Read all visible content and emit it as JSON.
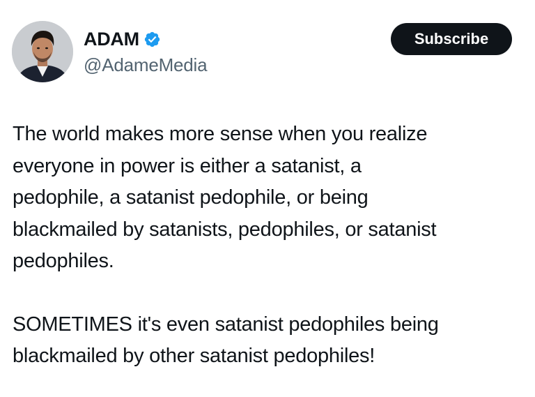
{
  "author": {
    "display_name": "ADAM",
    "handle": "@AdameMedia",
    "verified": true
  },
  "actions": {
    "subscribe_label": "Subscribe"
  },
  "post": {
    "paragraphs": [
      "The world makes more sense when you realize\neveryone in power is either a satanist, a\npedophile, a satanist pedophile, or being\nblackmailed by satanists, pedophiles, or satanist\npedophiles.",
      "SOMETIMES it's even satanist pedophiles being\nblackmailed by other satanist pedophiles!"
    ]
  },
  "colors": {
    "text": "#0f1419",
    "secondary_text": "#536471",
    "verified_badge": "#1d9bf0",
    "button_bg": "#0f1419",
    "button_text": "#ffffff"
  },
  "icons": {
    "avatar": "profile-photo",
    "verified": "verified-badge-icon"
  }
}
